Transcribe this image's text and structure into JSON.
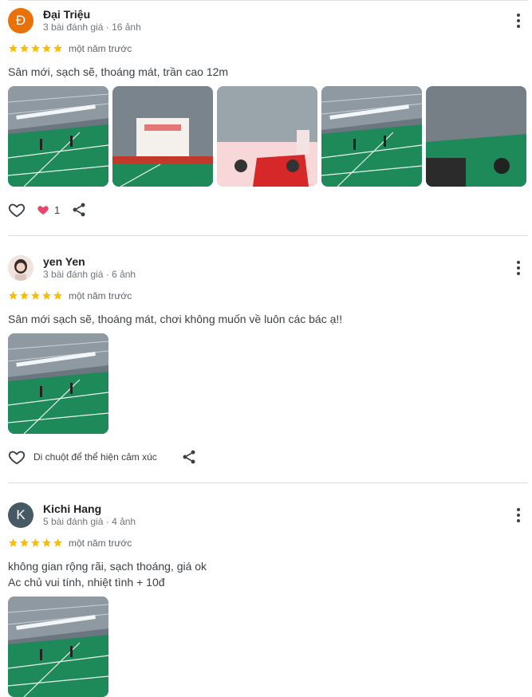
{
  "colors": {
    "star": "#fbbc04",
    "like": "#e8466c",
    "avatar_d": "#e8710a",
    "avatar_k": "#455a64",
    "court": "#1e8a5a"
  },
  "reviews": [
    {
      "name": "Đại Triệu",
      "avatar_letter": "Đ",
      "meta": "3 bài đánh giá · 16 ảnh",
      "when": "một năm trước",
      "text": "Sân mới, sạch sẽ, thoáng mát, trần cao 12m",
      "like_count": "1"
    },
    {
      "name": "yen Yen",
      "avatar_letter": "",
      "meta": "3 bài đánh giá · 6 ảnh",
      "when": "một năm trước",
      "text": "Sân mới sạch sẽ, thoáng mát, chơi không muốn về luôn các bác ạ!!",
      "hint": "Di chuột để thể hiện cảm xúc"
    },
    {
      "name": "Kichi Hang",
      "avatar_letter": "K",
      "meta": "5 bài đánh giá · 4 ảnh",
      "when": "một năm trước",
      "text_lines": [
        "không gian rộng rãi, sạch thoáng, giá ok",
        "Ac chủ vui tính, nhiệt tình + 10đ"
      ]
    }
  ],
  "rating": 5
}
